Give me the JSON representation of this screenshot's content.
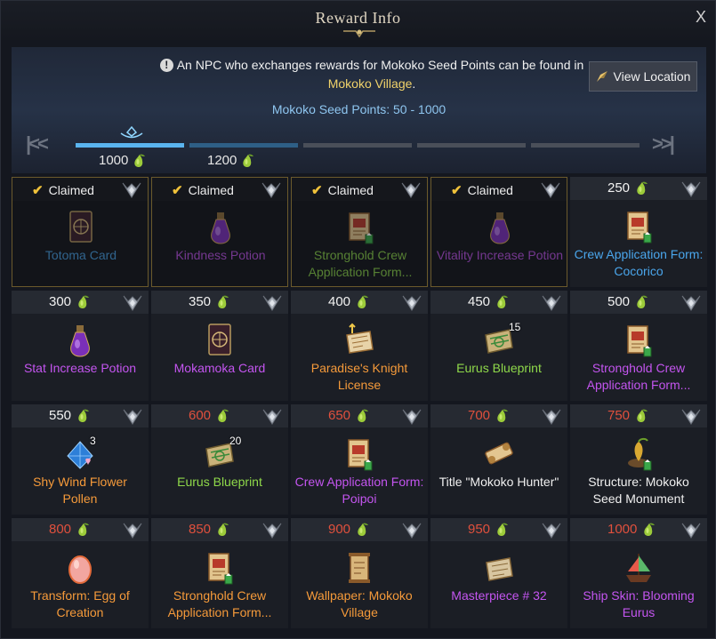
{
  "window": {
    "title": "Reward Info",
    "close_label": "X"
  },
  "notice": {
    "text_before": "An NPC who exchanges rewards for Mokoko Seed Points can be found in",
    "highlight": "Mokoko Village",
    "text_after": "."
  },
  "view_location_label": "View Location",
  "points_range": "Mokoko Seed Points: 50 - 1000",
  "progress": {
    "labels": [
      "1000",
      "1200"
    ],
    "first_icon": "skip-first-icon",
    "last_icon": "skip-last-icon"
  },
  "claimed_label": "Claimed",
  "colors": {
    "blue": "#4aa6ec",
    "purple": "#c455f0",
    "green": "#8fd94a",
    "orange": "#f59a3a",
    "white": "#f0f0f0",
    "red_cost": "#e0503d"
  },
  "rewards": [
    {
      "name": "Totoma Card",
      "cost": "",
      "claimed": true,
      "color": "blue",
      "icon": "card-icon",
      "qty": ""
    },
    {
      "name": "Kindness Potion",
      "cost": "",
      "claimed": true,
      "color": "purple",
      "icon": "potion-icon",
      "qty": ""
    },
    {
      "name": "Stronghold Crew Application Form...",
      "cost": "",
      "claimed": true,
      "color": "green",
      "icon": "scroll-icon",
      "qty": ""
    },
    {
      "name": "Vitality Increase Potion",
      "cost": "",
      "claimed": true,
      "color": "purple",
      "icon": "potion-icon",
      "qty": ""
    },
    {
      "name": "Crew Application Form: Cocorico",
      "cost": "250",
      "claimed": false,
      "color": "blue",
      "icon": "scroll-icon",
      "qty": ""
    },
    {
      "name": "Stat Increase Potion",
      "cost": "300",
      "claimed": false,
      "color": "purple",
      "icon": "potion-icon",
      "qty": ""
    },
    {
      "name": "Mokamoka Card",
      "cost": "350",
      "claimed": false,
      "color": "purple",
      "icon": "card-icon",
      "qty": ""
    },
    {
      "name": "Paradise's Knight License",
      "cost": "400",
      "claimed": false,
      "color": "orange",
      "icon": "license-icon",
      "qty": ""
    },
    {
      "name": "Eurus Blueprint",
      "cost": "450",
      "claimed": false,
      "color": "green",
      "icon": "blueprint-icon",
      "qty": "15"
    },
    {
      "name": "Stronghold Crew Application Form...",
      "cost": "500",
      "claimed": false,
      "color": "purple",
      "icon": "scroll-icon",
      "qty": ""
    },
    {
      "name": "Shy Wind Flower Pollen",
      "cost": "550",
      "claimed": false,
      "color": "orange",
      "icon": "pollen-icon",
      "qty": "3"
    },
    {
      "name": "Eurus Blueprint",
      "cost": "600",
      "claimed": false,
      "color": "green",
      "icon": "blueprint-icon",
      "qty": "20",
      "red": true
    },
    {
      "name": "Crew Application Form: Poipoi",
      "cost": "650",
      "claimed": false,
      "color": "purple",
      "icon": "scroll-icon",
      "qty": "",
      "red": true
    },
    {
      "name": "Title \"Mokoko Hunter\"",
      "cost": "700",
      "claimed": false,
      "color": "white",
      "icon": "title-scroll-icon",
      "qty": "",
      "red": true
    },
    {
      "name": "Structure: Mokoko Seed Monument",
      "cost": "750",
      "claimed": false,
      "color": "white",
      "icon": "structure-icon",
      "qty": "",
      "red": true
    },
    {
      "name": "Transform: Egg of Creation",
      "cost": "800",
      "claimed": false,
      "color": "orange",
      "icon": "egg-icon",
      "qty": "",
      "red": true
    },
    {
      "name": "Stronghold Crew Application Form...",
      "cost": "850",
      "claimed": false,
      "color": "orange",
      "icon": "scroll-icon",
      "qty": "",
      "red": true
    },
    {
      "name": "Wallpaper: Mokoko Village",
      "cost": "900",
      "claimed": false,
      "color": "orange",
      "icon": "wallpaper-icon",
      "qty": "",
      "red": true
    },
    {
      "name": "Masterpiece # 32",
      "cost": "950",
      "claimed": false,
      "color": "purple",
      "icon": "masterpiece-icon",
      "qty": "",
      "red": true
    },
    {
      "name": "Ship Skin: Blooming Eurus",
      "cost": "1000",
      "claimed": false,
      "color": "purple",
      "icon": "ship-icon",
      "qty": "",
      "red": true
    }
  ]
}
